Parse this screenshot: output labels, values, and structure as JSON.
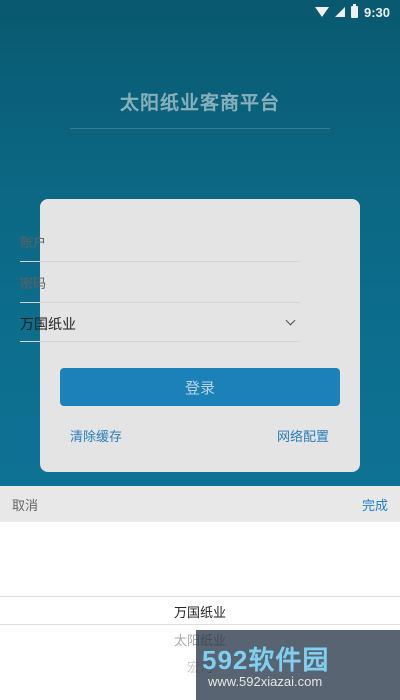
{
  "status_bar": {
    "time": "9:30"
  },
  "app": {
    "title": "太阳纸业客商平台"
  },
  "login": {
    "account_placeholder": "账户",
    "password_placeholder": "密码",
    "company_value": "万国纸业",
    "login_label": "登录",
    "clear_cache_label": "清除缓存",
    "network_config_label": "网络配置"
  },
  "picker": {
    "cancel_label": "取消",
    "done_label": "完成",
    "options": [
      "万国纸业",
      "太阳纸业",
      "宏河"
    ]
  },
  "watermark": {
    "main": "592软件园",
    "url": "www.592xiazai.com"
  },
  "colors": {
    "accent": "#1d8ac4",
    "header_bg": "#0d6f8d",
    "link": "#2a86c6"
  }
}
